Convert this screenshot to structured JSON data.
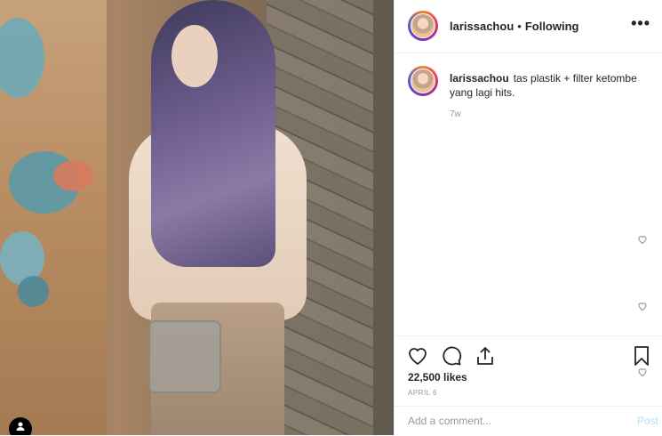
{
  "post": {
    "username": "larissachou",
    "separator": "•",
    "follow_status": "Following",
    "more_glyph": "•••"
  },
  "caption": {
    "username": "larissachou",
    "text": "tas plastik + filter ketombe yang lagi hits.",
    "age": "7w"
  },
  "actions": {
    "likes": "22,500 likes",
    "date": "APRIL 6"
  },
  "comment": {
    "placeholder": "Add a comment...",
    "post_label": "Post"
  },
  "colors": {
    "text": "#262626",
    "muted": "#999999",
    "post_disabled": "#b2dffc",
    "divider": "#efefef"
  },
  "icons": [
    "heart-icon",
    "comment-icon",
    "share-icon",
    "bookmark-icon",
    "more-icon",
    "user-tag-icon"
  ]
}
